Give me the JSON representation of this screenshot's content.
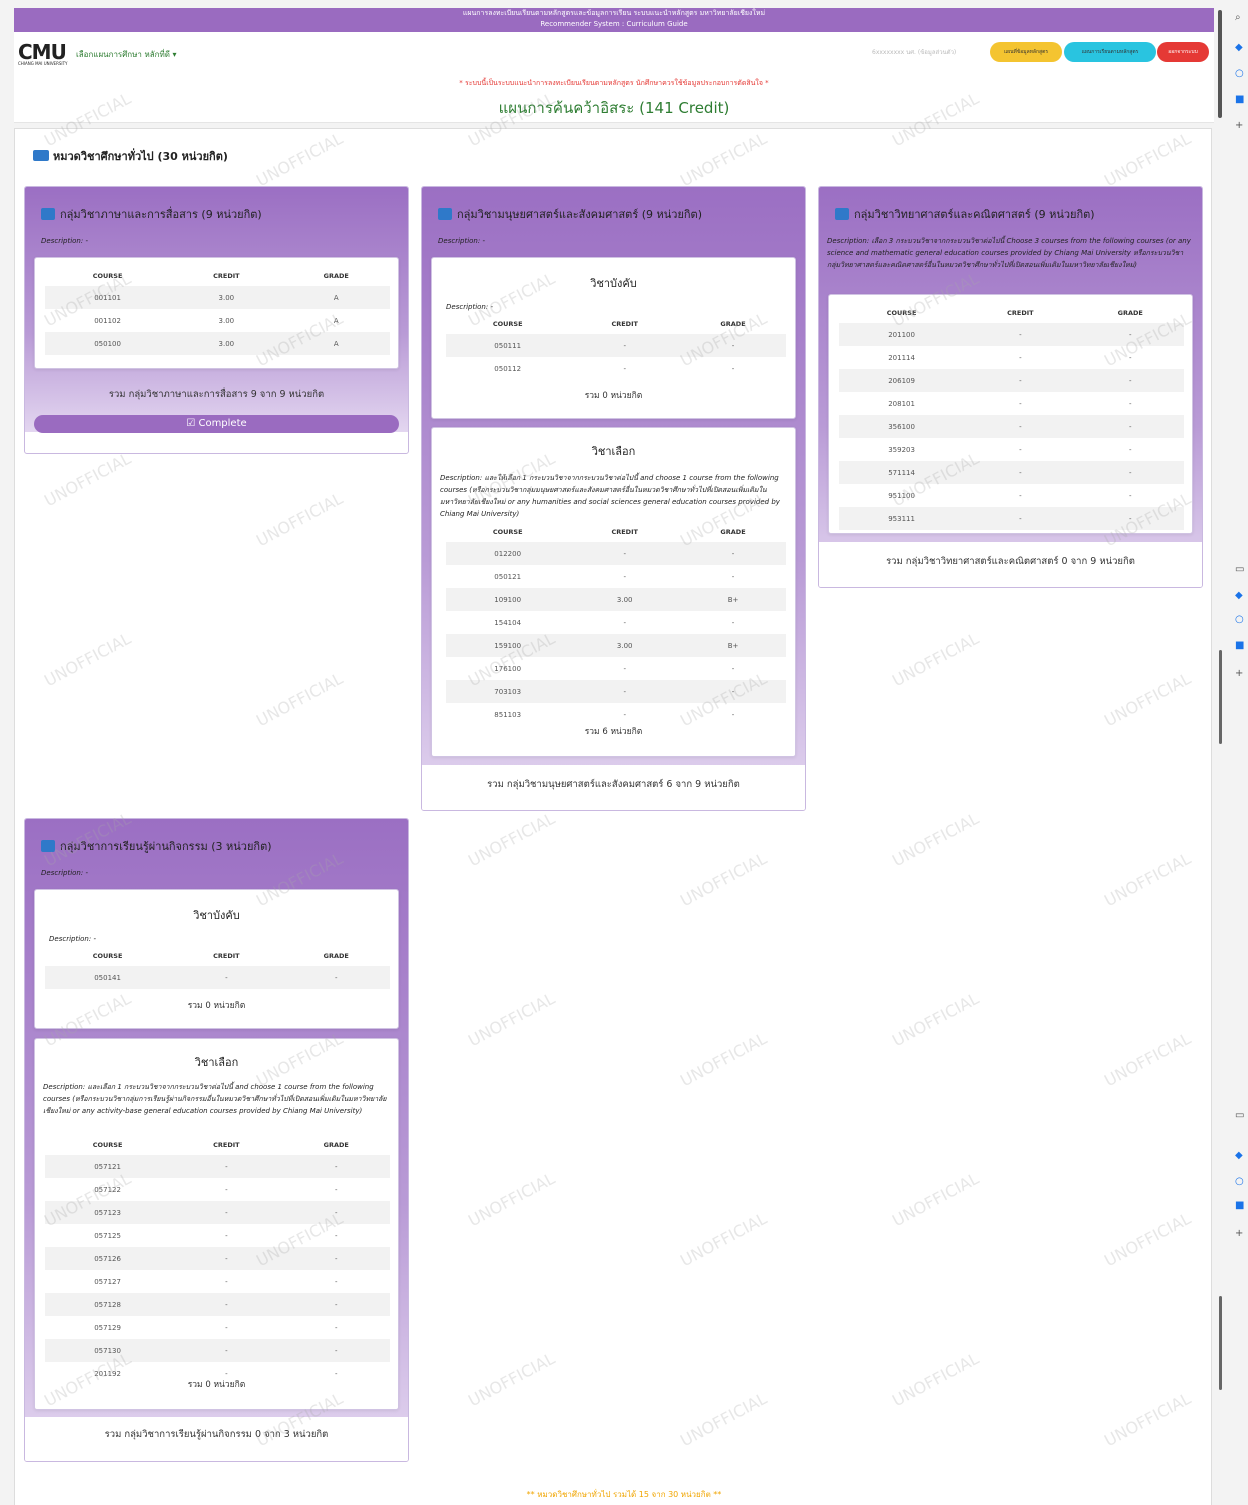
{
  "header": {
    "top_line1": "แผนการลงทะเบียนเรียนตามหลักสูตรและข้อมูลการเรียน ระบบแนะนำหลักสูตร มหาวิทยาลัยเชียงใหม่",
    "top_line2": "Recommender System : Curriculum Guide",
    "logo": "CMU",
    "logo_sub": "CHIANG MAI UNIVERSITY",
    "semester_selector": "เลือกแผนการศึกษา หลักที่ดี",
    "user_info": "6xxxxxxxx นศ. (ข้อมูลส่วนตัว)",
    "btn_yellow": "แผนที่ข้อมูลหลักสูตร",
    "btn_cyan": "แผนการเรียนตามหลักสูตร",
    "btn_red": "ออกจากระบบ",
    "notice": "* ระบบนี้เป็นระบบแนะนำการลงทะเบียนเรียนตามหลักสูตร นักศึกษาควรใช้ข้อมูลประกอบการตัดสินใจ *",
    "plan_title": "แผนการค้นคว้าอิสระ (141 Credit)"
  },
  "section": {
    "title": "หมวดวิชาศึกษาทั่วไป (30 หน่วยกิต)"
  },
  "table_headers": {
    "course": "COURSE",
    "credit": "CREDIT",
    "grade": "GRADE"
  },
  "groups": {
    "lang": {
      "title": "กลุ่มวิชาภาษาและการสื่อสาร (9 หน่วยกิต)",
      "description": "Description: -",
      "rows": [
        [
          "001101",
          "3.00",
          "A"
        ],
        [
          "001102",
          "3.00",
          "A"
        ],
        [
          "050100",
          "3.00",
          "A"
        ]
      ],
      "summary": "รวม กลุ่มวิชาภาษาและการสื่อสาร 9 จาก 9 หน่วยกิต",
      "complete_label": "Complete"
    },
    "hum": {
      "title": "กลุ่มวิชามนุษยศาสตร์และสังคมศาสตร์ (9 หน่วยกิต)",
      "description": "Description: -",
      "required": {
        "title": "วิชาบังคับ",
        "description": "Description: -",
        "rows": [
          [
            "050111",
            "-",
            "-"
          ],
          [
            "050112",
            "-",
            "-"
          ]
        ],
        "summary": "รวม 0 หน่วยกิต"
      },
      "elective": {
        "title": "วิชาเลือก",
        "description": "Description: และให้เลือก 1 กระบวนวิชาจากกระบวนวิชาต่อไปนี้ and choose 1 course from the following courses (หรือกระบวนวิชากลุ่มมนุษยศาสตร์และสังคมศาสตร์อื่นในหมวดวิชาศึกษาทั่วไปที่เปิดสอนเพิ่มเติมในมหาวิทยาลัยเชียงใหม่ or any humanities and social sciences general education courses provided by Chiang Mai University)",
        "rows": [
          [
            "012200",
            "-",
            "-"
          ],
          [
            "050121",
            "-",
            "-"
          ],
          [
            "109100",
            "3.00",
            "B+"
          ],
          [
            "154104",
            "-",
            "-"
          ],
          [
            "159100",
            "3.00",
            "B+"
          ],
          [
            "176100",
            "-",
            "-"
          ],
          [
            "703103",
            "-",
            "-"
          ],
          [
            "851103",
            "-",
            "-"
          ]
        ],
        "summary": "รวม 6 หน่วยกิต"
      },
      "summary": "รวม กลุ่มวิชามนุษยศาสตร์และสังคมศาสตร์ 6 จาก 9 หน่วยกิต"
    },
    "sci": {
      "title": "กลุ่มวิชาวิทยาศาสตร์และคณิตศาสตร์ (9 หน่วยกิต)",
      "description": "Description: เลือก 3 กระบวนวิชาจากกระบวนวิชาต่อไปนี้ Choose 3 courses from the following courses (or any science and mathematic general education courses provided by Chiang Mai University หรือกระบวนวิชากลุ่มวิทยาศาสตร์และคณิตศาสตร์อื่นในหมวดวิชาศึกษาทั่วไปที่เปิดสอนเพิ่มเติมในมหาวิทยาลัยเชียงใหม่)",
      "rows": [
        [
          "201100",
          "-",
          "-"
        ],
        [
          "201114",
          "-",
          "-"
        ],
        [
          "206109",
          "-",
          "-"
        ],
        [
          "208101",
          "-",
          "-"
        ],
        [
          "356100",
          "-",
          "-"
        ],
        [
          "359203",
          "-",
          "-"
        ],
        [
          "571114",
          "-",
          "-"
        ],
        [
          "951100",
          "-",
          "-"
        ],
        [
          "953111",
          "-",
          "-"
        ]
      ],
      "summary": "รวม กลุ่มวิชาวิทยาศาสตร์และคณิตศาสตร์ 0 จาก 9 หน่วยกิต"
    },
    "act": {
      "title": "กลุ่มวิชาการเรียนรู้ผ่านกิจกรรม (3 หน่วยกิต)",
      "description": "Description: -",
      "required": {
        "title": "วิชาบังคับ",
        "description": "Description: -",
        "rows": [
          [
            "050141",
            "-",
            "-"
          ]
        ],
        "summary": "รวม 0 หน่วยกิต"
      },
      "elective": {
        "title": "วิชาเลือก",
        "description": "Description: และเลือก 1 กระบวนวิชาจากกระบวนวิชาต่อไปนี้ and choose 1 course from the following courses (หรือกระบวนวิชากลุ่มการเรียนรู้ผ่านกิจกรรมอื่นในหมวดวิชาศึกษาทั่วไปที่เปิดสอนเพิ่มเติมในมหาวิทยาลัยเชียงใหม่ or any activity-base general education courses provided by Chiang Mai University)",
        "rows": [
          [
            "057121",
            "-",
            "-"
          ],
          [
            "057122",
            "-",
            "-"
          ],
          [
            "057123",
            "-",
            "-"
          ],
          [
            "057125",
            "-",
            "-"
          ],
          [
            "057126",
            "-",
            "-"
          ],
          [
            "057127",
            "-",
            "-"
          ],
          [
            "057128",
            "-",
            "-"
          ],
          [
            "057129",
            "-",
            "-"
          ],
          [
            "057130",
            "-",
            "-"
          ],
          [
            "201192",
            "-",
            "-"
          ]
        ],
        "summary": "รวม 0 หน่วยกิต"
      },
      "summary": "รวม กลุ่มวิชาการเรียนรู้ผ่านกิจกรรม 0 จาก 3 หน่วยกิต"
    }
  },
  "footer_total": "** หมวดวิชาศึกษาทั่วไป รวมได้ 15 จาก 30 หน่วยกิต **",
  "watermark": "UNOFFICIAL"
}
